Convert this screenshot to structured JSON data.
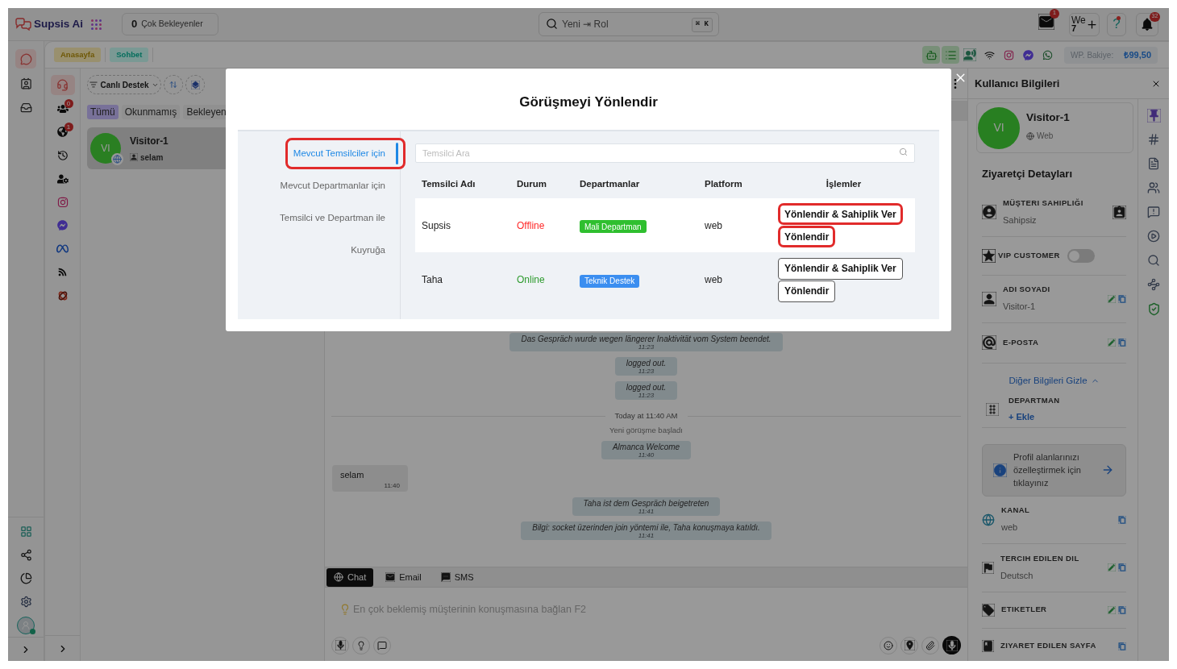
{
  "header": {
    "logo": "Supsis Ai",
    "waiting_count": "0",
    "waiting_label": "Çok Bekleyenler",
    "search": {
      "value": "Yeni ⇥ Rol",
      "shortcut": "⌘ K"
    },
    "mail_badge": "1",
    "workspace": [
      "We",
      "7"
    ],
    "help": "?",
    "notification_badge": "32"
  },
  "tabs": [
    {
      "label": "Anasayfa",
      "color": "#99906e"
    },
    {
      "label": "Sohbet",
      "color": "#7a9994"
    }
  ],
  "channel_icons": [
    {
      "kind": "bot",
      "active": true
    },
    {
      "kind": "list",
      "active": true
    },
    {
      "kind": "voice",
      "active": false
    },
    {
      "kind": "wifi",
      "active": false
    },
    {
      "kind": "instagram",
      "active": false
    },
    {
      "kind": "messenger",
      "active": false
    },
    {
      "kind": "whatsapp",
      "active": false
    }
  ],
  "balance": {
    "label": "WP. Bakiye:",
    "value": "₺99,50"
  },
  "left_rail": [
    {
      "kind": "chat",
      "selected": true
    },
    {
      "kind": "contacts",
      "selected": false
    },
    {
      "kind": "inbox",
      "selected": false
    }
  ],
  "profile": {
    "online": true
  },
  "channel_rail": [
    {
      "kind": "headset",
      "selected": true
    },
    {
      "kind": "visitors",
      "badge": "0",
      "selected": false
    },
    {
      "kind": "web",
      "badge": "1",
      "selected": false
    },
    {
      "kind": "history",
      "selected": false
    },
    {
      "kind": "agents",
      "selected": false
    },
    {
      "kind": "instagram",
      "selected": false
    },
    {
      "kind": "messenger",
      "selected": false
    },
    {
      "kind": "meta",
      "selected": false
    },
    {
      "kind": "rss",
      "selected": false
    },
    {
      "kind": "brand",
      "selected": false
    }
  ],
  "conversation_list": {
    "filter": "Canlı Destek",
    "tabs": [
      {
        "label": "Tümü",
        "selected": true
      },
      {
        "label": "Okunmamış",
        "selected": false
      },
      {
        "label": "Bekleyen",
        "selected": false
      }
    ],
    "items": [
      {
        "initials": "VI",
        "name": "Visitor-1",
        "preview": "selam",
        "selected": true
      }
    ]
  },
  "chat": {
    "messages": [
      {
        "kind": "system",
        "text": "Das Gespräch wurde wegen längerer Inaktivität vom System beendet.",
        "time": "11:23"
      },
      {
        "kind": "system",
        "text": "logged out.",
        "time": "11:23"
      },
      {
        "kind": "system",
        "text": "logged out.",
        "time": "11:23"
      },
      {
        "kind": "divider",
        "text": "Today at 11:40 AM"
      },
      {
        "kind": "note",
        "text": "Yeni görüşme başladı"
      },
      {
        "kind": "system",
        "text": "Almanca Welcome",
        "time": "11:40"
      },
      {
        "kind": "incoming",
        "text": "selam",
        "time": "11:40"
      },
      {
        "kind": "system",
        "text": "Taha ist dem Gespräch beigetreten",
        "time": "11:41"
      },
      {
        "kind": "system",
        "text": "Bilgi: socket üzerinden join yöntemi ile, Taha konuşmaya katıldı.",
        "time": "11:41"
      }
    ],
    "composer": {
      "tabs": [
        {
          "kind": "chat",
          "label": "Chat",
          "selected": true
        },
        {
          "kind": "email",
          "label": "Email",
          "selected": false
        },
        {
          "kind": "sms",
          "label": "SMS",
          "selected": false
        }
      ],
      "placeholder": "En çok beklemiş müşterinin konuşmasına bağlan F2"
    }
  },
  "user_info": {
    "title": "Kullanıcı Bilgileri",
    "initials": "VI",
    "name": "Visitor-1",
    "channel": "Web",
    "section": "Ziyaretçi Detayları",
    "fields": [
      {
        "kind": "owner",
        "label": "MÜŞTERI SAHIPLIĞI",
        "value": "Sahipsiz"
      },
      {
        "kind": "vip",
        "label": "VIP CUSTOMER",
        "on": false
      },
      {
        "kind": "name",
        "label": "ADI SOYADI",
        "value": "Visitor-1",
        "editable": true
      },
      {
        "kind": "email",
        "label": "E-POSTA",
        "editable": true
      }
    ],
    "details_toggle": {
      "label": "Diğer Bilgileri Gizle",
      "expanded": true
    },
    "department": {
      "label": "DEPARTMAN",
      "action": "+ Ekle"
    },
    "notice": "Profil alanlarınızı özelleştirmek için tıklayınız",
    "more_fields": [
      {
        "kind": "channel",
        "label": "KANAL",
        "value": "web",
        "editable": false
      },
      {
        "kind": "language",
        "label": "TERCIH EDILEN DIL",
        "value": "Deutsch",
        "editable": true
      },
      {
        "kind": "tags",
        "label": "ETIKETLER",
        "editable": true
      },
      {
        "kind": "page",
        "label": "ZIYARET EDILEN SAYFA",
        "editable": false
      }
    ]
  },
  "dialog": {
    "title": "Görüşmeyi Yönlendir",
    "nav": [
      {
        "label": "Mevcut Temsilciler için",
        "selected": true,
        "highlighted": true
      },
      {
        "label": "Mevcut Departmanlar için",
        "selected": false,
        "highlighted": false
      },
      {
        "label": "Temsilci ve Departman ile",
        "selected": false,
        "highlighted": false
      },
      {
        "label": "Kuyruğa",
        "selected": false,
        "highlighted": false
      }
    ],
    "search_placeholder": "Temsilci Ara",
    "columns": [
      "Temsilci Adı",
      "Durum",
      "Departmanlar",
      "Platform",
      "İşlemler"
    ],
    "rows": [
      {
        "name": "Supsis",
        "status": "Offline",
        "online": false,
        "department": "Mali Departman",
        "color": "#2fbf2f",
        "platform": "web",
        "selected": true,
        "actions": [
          {
            "label": "Yönlendir & Sahiplik Ver",
            "highlighted": true
          },
          {
            "label": "Yönlendir",
            "highlighted": true
          }
        ]
      },
      {
        "name": "Taha",
        "status": "Online",
        "online": true,
        "department": "Teknik Destek",
        "color": "#3b8ef0",
        "platform": "web",
        "selected": false,
        "actions": [
          {
            "label": "Yönlendir & Sahiplik Ver",
            "highlighted": false
          },
          {
            "label": "Yönlendir",
            "highlighted": false
          }
        ]
      }
    ]
  }
}
